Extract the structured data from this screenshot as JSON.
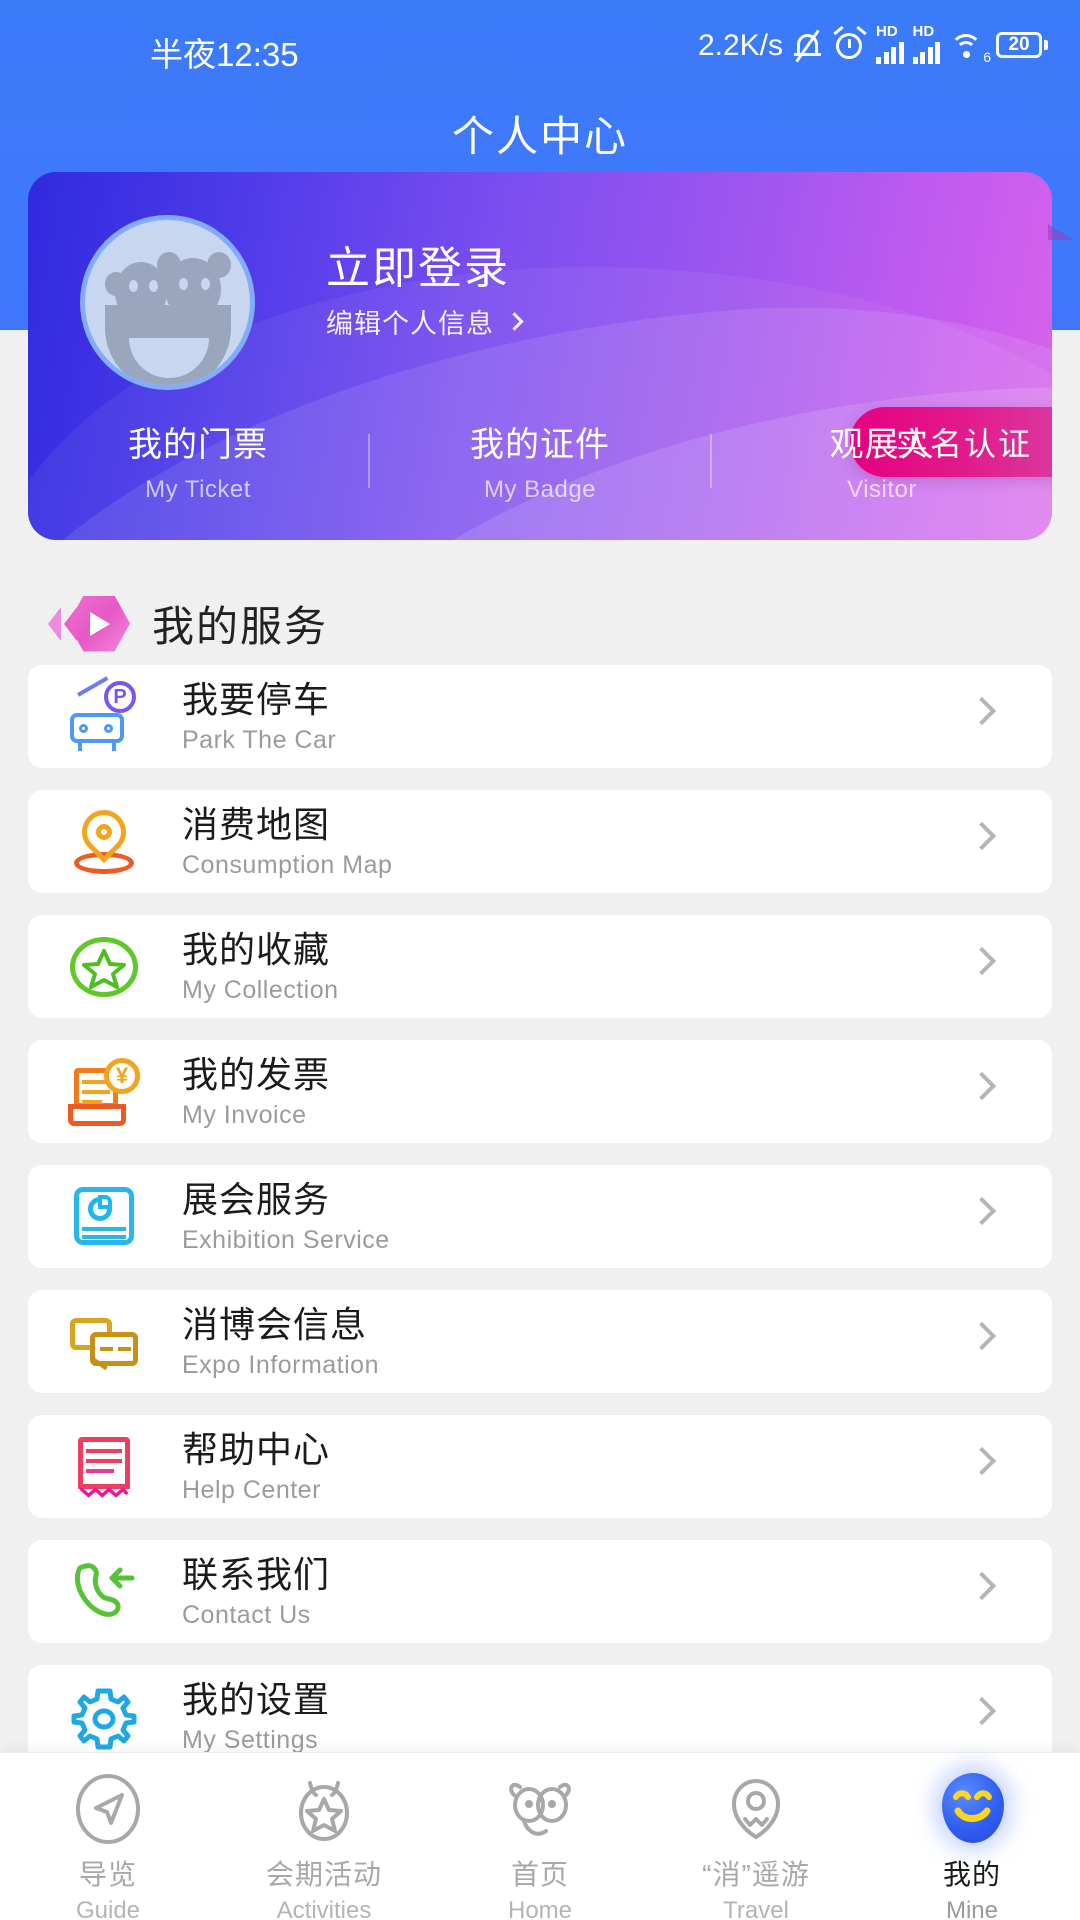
{
  "statusbar": {
    "time": "半夜12:35",
    "network_speed": "2.2K/s",
    "battery_level": "20",
    "hd_label_1": "HD",
    "hd_label_2": "HD",
    "wifi_gen": "6",
    "icons": [
      "mute-bell-icon",
      "alarm-icon",
      "signal-icon",
      "signal-icon",
      "wifi-icon",
      "battery-icon"
    ]
  },
  "header": {
    "title": "个人中心"
  },
  "profile": {
    "login_label": "立即登录",
    "edit_label": "编辑个人信息",
    "verify_badge": "实名认证",
    "tabs": [
      {
        "cn": "我的门票",
        "en": "My Ticket"
      },
      {
        "cn": "我的证件",
        "en": "My Badge"
      },
      {
        "cn": "观展人",
        "en": "Visitor"
      }
    ]
  },
  "section": {
    "title": "我的服务"
  },
  "services": [
    {
      "cn": "我要停车",
      "en": "Park The Car",
      "icon": "parking-car-icon",
      "color": "#5b7ff2"
    },
    {
      "cn": "消费地图",
      "en": "Consumption Map",
      "icon": "map-pin-icon",
      "color": "#f5861f"
    },
    {
      "cn": "我的收藏",
      "en": "My Collection",
      "icon": "star-circle-icon",
      "color": "#5fc92a"
    },
    {
      "cn": "我的发票",
      "en": "My Invoice",
      "icon": "invoice-yuan-icon",
      "color": "#f07c1d"
    },
    {
      "cn": "展会服务",
      "en": "Exhibition Service",
      "icon": "exhibition-card-icon",
      "color": "#2ab7e8"
    },
    {
      "cn": "消博会信息",
      "en": "Expo Information",
      "icon": "chat-bubbles-icon",
      "color": "#d9a520"
    },
    {
      "cn": "帮助中心",
      "en": "Help Center",
      "icon": "receipt-help-icon",
      "color": "#ef3f5e"
    },
    {
      "cn": "联系我们",
      "en": "Contact Us",
      "icon": "phone-incoming-icon",
      "color": "#5fc92a"
    },
    {
      "cn": "我的设置",
      "en": "My Settings",
      "icon": "gear-icon",
      "color": "#1fa8e8"
    }
  ],
  "tabbar": {
    "items": [
      {
        "cn": "导览",
        "en": "Guide",
        "icon": "navigation-compass-icon",
        "active": false
      },
      {
        "cn": "会期活动",
        "en": "Activities",
        "icon": "medal-star-icon",
        "active": false
      },
      {
        "cn": "首页",
        "en": "Home",
        "icon": "mascot-home-icon",
        "active": false
      },
      {
        "cn": "“消”遥游",
        "en": "Travel",
        "icon": "location-travel-icon",
        "active": false
      },
      {
        "cn": "我的",
        "en": "Mine",
        "icon": "smiley-face-icon",
        "active": true
      }
    ]
  },
  "colors": {
    "header_blue": "#3f79fb",
    "card_gradient_start": "#2f2ae0",
    "card_gradient_end": "#d864e8",
    "badge_pink": "#e6007e",
    "page_bg": "#f0f0f0",
    "active_nav": "#2f5ff0"
  }
}
